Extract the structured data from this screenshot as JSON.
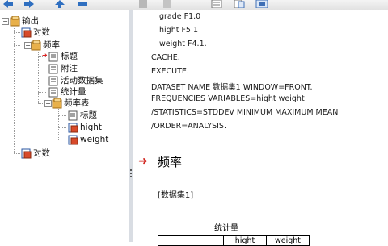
{
  "toolbar": {
    "buttons": [
      {
        "name": "back-arrow-icon"
      },
      {
        "name": "forward-arrow-icon"
      },
      {
        "name": "promote-icon"
      },
      {
        "name": "demote-icon"
      },
      {
        "name": "collapse-icon"
      },
      {
        "name": "expand-icon"
      },
      {
        "name": "show-icon"
      },
      {
        "name": "hide-icon"
      },
      {
        "name": "designated-window-icon"
      }
    ]
  },
  "tree": {
    "output": "输出",
    "log1": "对数",
    "frequencies": "频率",
    "title": "标题",
    "notes": "附注",
    "active_dataset": "活动数据集",
    "statistics": "统计量",
    "freq_table": "频率表",
    "ft_title": "标题",
    "hight": "hight",
    "weight": "weight",
    "log2": "对数"
  },
  "syntax": {
    "lines": [
      "grade F1.0",
      "hight F5.1",
      "weight F4.1.",
      "CACHE.",
      "EXECUTE.",
      "DATASET NAME 数据集1 WINDOW=FRONT.",
      "FREQUENCIES VARIABLES=hight weight",
      "  /STATISTICS=STDDEV MINIMUM MAXIMUM MEAN",
      "  /ORDER=ANALYSIS."
    ]
  },
  "output": {
    "heading": "频率",
    "dataset": "[数据集1]",
    "stats_title": "统计量",
    "table_cols": [
      "",
      "hight",
      "weight"
    ]
  }
}
